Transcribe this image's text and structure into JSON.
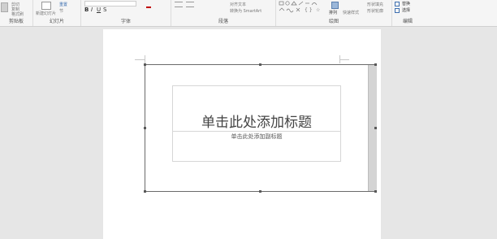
{
  "ribbon": {
    "groups": {
      "clipboard": {
        "label": "剪贴板",
        "cut": "剪切",
        "copy": "复制",
        "format": "格式刷"
      },
      "slides": {
        "label": "幻灯片",
        "new_slide": "新建幻灯片",
        "reset": "重置",
        "section": "节"
      },
      "font": {
        "label": "字体",
        "bold": "B",
        "italic": "I",
        "underline": "U",
        "shadow": "S"
      },
      "paragraph": {
        "label": "段落",
        "align_text": "对齐文本",
        "smartart": "转换为 SmartArt"
      },
      "drawing": {
        "label": "绘图",
        "arrange": "排列",
        "quick_styles": "快速样式",
        "fill": "形状填充",
        "outline": "形状轮廓"
      },
      "editing": {
        "label": "编辑",
        "replace": "替换",
        "select": "选择"
      }
    }
  },
  "slide": {
    "title_placeholder": "单击此处添加标题",
    "subtitle_placeholder": "单击此处添加副标题"
  }
}
